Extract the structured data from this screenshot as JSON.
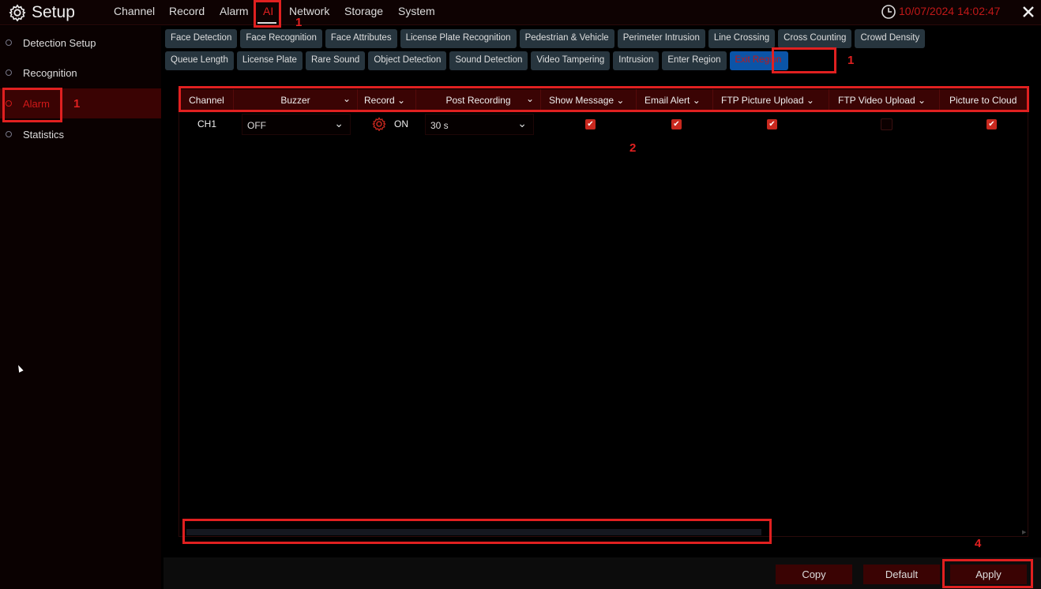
{
  "header": {
    "title": "Setup",
    "nav": [
      "Channel",
      "Record",
      "Alarm",
      "AI",
      "Network",
      "Storage",
      "System"
    ],
    "active_nav": "AI",
    "datetime": "10/07/2024 14:02:47"
  },
  "sidebar": {
    "items": [
      "Detection Setup",
      "Recognition",
      "Alarm",
      "Statistics"
    ],
    "active": "Alarm"
  },
  "tabs": {
    "row1": [
      "Face Detection",
      "Face Recognition",
      "Face Attributes",
      "License Plate Recognition",
      "Pedestrian & Vehicle",
      "Perimeter Intrusion",
      "Line Crossing",
      "Cross Counting",
      "Crowd Density"
    ],
    "row2": [
      "Queue Length",
      "License Plate",
      "Rare Sound",
      "Object Detection",
      "Sound Detection",
      "Video Tampering",
      "Intrusion",
      "Enter Region",
      "Exit Region"
    ],
    "active": "Exit Region"
  },
  "table": {
    "columns": [
      "Channel",
      "Buzzer",
      "Record",
      "Post Recording",
      "Show Message",
      "Email Alert",
      "FTP Picture Upload",
      "FTP Video Upload",
      "Picture to Cloud"
    ],
    "rows": [
      {
        "channel": "CH1",
        "buzzer": "OFF",
        "record": "ON",
        "post_recording": "30 s",
        "show_message": true,
        "email_alert": true,
        "ftp_picture_upload": true,
        "ftp_video_upload": false,
        "picture_to_cloud": true
      }
    ]
  },
  "footer": {
    "copy": "Copy",
    "default": "Default",
    "apply": "Apply"
  },
  "annotations": {
    "a1": "1",
    "a2": "2",
    "a4": "4"
  },
  "colors": {
    "accent": "#e02020",
    "header_row": "#3a0404",
    "active_tab": "#0b54a8"
  }
}
